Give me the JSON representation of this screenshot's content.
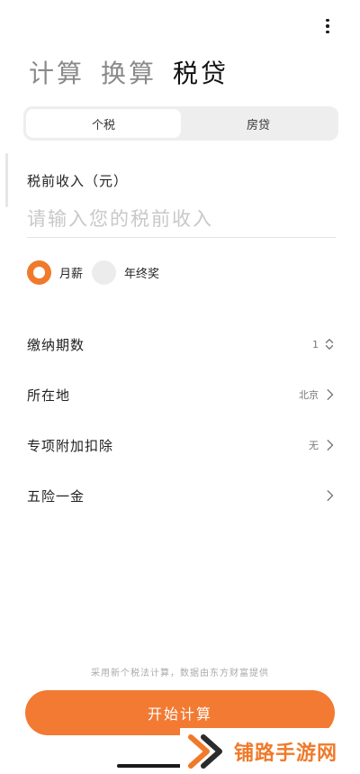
{
  "header": {
    "tabs": [
      {
        "label": "计算",
        "active": false
      },
      {
        "label": "换算",
        "active": false
      },
      {
        "label": "税贷",
        "active": true
      }
    ],
    "menu_icon": "more-vertical-icon"
  },
  "segment": {
    "options": [
      {
        "label": "个税",
        "active": true
      },
      {
        "label": "房贷",
        "active": false
      }
    ]
  },
  "income": {
    "label": "税前收入（元）",
    "placeholder": "请输入您的税前收入",
    "value": ""
  },
  "salary_type": {
    "options": [
      {
        "label": "月薪",
        "selected": true
      },
      {
        "label": "年终奖",
        "selected": false
      }
    ]
  },
  "settings": [
    {
      "label": "缴纳期数",
      "value": "1",
      "icon": "chevron-up-down-icon"
    },
    {
      "label": "所在地",
      "value": "北京",
      "icon": "chevron-right-icon"
    },
    {
      "label": "专项附加扣除",
      "value": "无",
      "icon": "chevron-right-icon"
    },
    {
      "label": "五险一金",
      "value": "",
      "icon": "chevron-right-icon"
    }
  ],
  "footer": {
    "disclaimer": "采用新个税法计算，数据由东方财富提供",
    "cta_label": "开始计算"
  },
  "watermark": {
    "text": "铺路手游网"
  },
  "colors": {
    "accent": "#f07a2a",
    "cta": "#f27a33",
    "segment_bg": "#eeeeee",
    "text_muted": "#8a8a8a"
  }
}
